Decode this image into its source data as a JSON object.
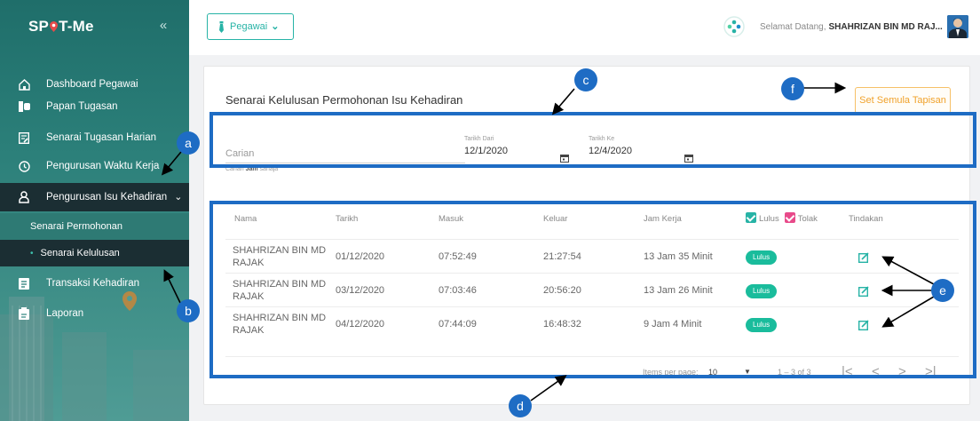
{
  "brand": {
    "prefix": "SP",
    "suffix": "T-Me"
  },
  "sidebar": {
    "collapse_icon": "double-chevron-left-icon",
    "items": [
      {
        "label": "Dashboard Pegawai",
        "icon": "home-icon"
      },
      {
        "label": "Papan Tugasan",
        "icon": "board-icon"
      },
      {
        "label": "Senarai Tugasan Harian",
        "icon": "edit-list-icon"
      },
      {
        "label": "Pengurusan Waktu Kerja",
        "icon": "clock-history-icon"
      },
      {
        "label": "Pengurusan Isu Kehadiran",
        "icon": "person-icon",
        "chevron": "⌄"
      },
      {
        "label": "Transaksi Kehadiran",
        "icon": "document-icon"
      },
      {
        "label": "Laporan",
        "icon": "clipboard-icon"
      }
    ],
    "sub_items": [
      {
        "label": "Senarai Permohonan"
      },
      {
        "label": "Senarai Kelulusan",
        "bullet": "•"
      }
    ]
  },
  "topbar": {
    "role_label": "Pegawai",
    "role_caret": "⌄",
    "greeting": "Selamat Datang,",
    "user_name": "SHAHRIZAN BIN MD RAJ..."
  },
  "page": {
    "title": "Senarai Kelulusan Permohonan Isu Kehadiran",
    "reset_button": "Set Semula Tapisan"
  },
  "filters": {
    "search_label": "Carian",
    "search_hint_prefix": "Carian",
    "search_hint_bold": "Jam",
    "search_hint_suffix": "sahaja",
    "date_from_label": "Tarikh Dari",
    "date_from_value": "12/1/2020",
    "date_to_label": "Tarikh Ke",
    "date_to_value": "12/4/2020"
  },
  "table": {
    "headers": {
      "nama": "Nama",
      "tarikh": "Tarikh",
      "masuk": "Masuk",
      "keluar": "Keluar",
      "jam_kerja": "Jam Kerja",
      "lulus": "Lulus",
      "tolak": "Tolak",
      "tindakan": "Tindakan"
    },
    "rows": [
      {
        "nama": "SHAHRIZAN BIN MD RAJAK",
        "tarikh": "01/12/2020",
        "masuk": "07:52:49",
        "keluar": "21:27:54",
        "jam_kerja": "13 Jam 35 Minit",
        "status": "Lulus"
      },
      {
        "nama": "SHAHRIZAN BIN MD RAJAK",
        "tarikh": "03/12/2020",
        "masuk": "07:03:46",
        "keluar": "20:56:20",
        "jam_kerja": "13 Jam 26 Minit",
        "status": "Lulus"
      },
      {
        "nama": "SHAHRIZAN BIN MD RAJAK",
        "tarikh": "04/12/2020",
        "masuk": "07:44:09",
        "keluar": "16:48:32",
        "jam_kerja": "9 Jam 4 Minit",
        "status": "Lulus"
      }
    ],
    "paginator": {
      "items_per_page_label": "Items per page:",
      "items_per_page_value": "10",
      "range": "1 – 3 of 3",
      "first": "|<",
      "prev": "<",
      "next": ">",
      "last": ">|"
    }
  },
  "callouts": {
    "a": "a",
    "b": "b",
    "c": "c",
    "d": "d",
    "e": "e",
    "f": "f"
  },
  "colors": {
    "accent": "#27b3a6",
    "badge": "#1abc9c",
    "highlight": "#1e6cc4",
    "warning": "#f0a22b"
  }
}
